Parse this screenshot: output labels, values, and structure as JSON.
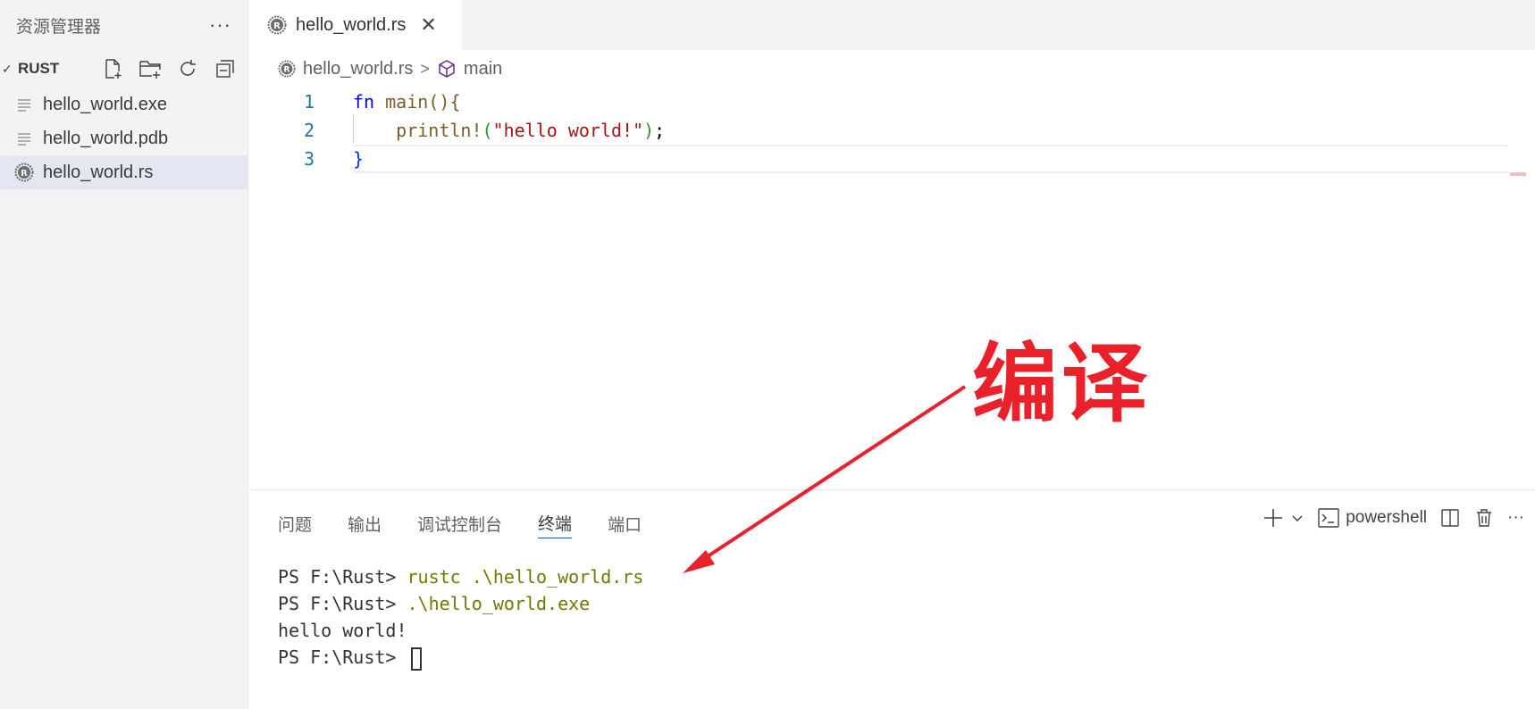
{
  "sidebar": {
    "title": "资源管理器",
    "more": "···",
    "section_title": "RUST",
    "section_chevron": "✓",
    "actions": [
      "new-file-icon",
      "new-folder-icon",
      "refresh-icon",
      "collapse-all-icon"
    ],
    "files": [
      {
        "name": "hello_world.exe",
        "icon": "file-lines-icon"
      },
      {
        "name": "hello_world.pdb",
        "icon": "file-lines-icon"
      },
      {
        "name": "hello_world.rs",
        "icon": "rust-icon",
        "selected": true
      }
    ]
  },
  "tab": {
    "label": "hello_world.rs",
    "close": "✕"
  },
  "breadcrumb": {
    "file": "hello_world.rs",
    "separator": ">",
    "symbol": "main"
  },
  "editor": {
    "line_numbers": [
      "1",
      "2",
      "3"
    ],
    "lines": [
      {
        "kw": "fn",
        "rest": " main(){"
      },
      {
        "fn": "println!",
        "str": "\"hello world!\"",
        "end": ";"
      },
      {
        "text": "}"
      }
    ]
  },
  "panel": {
    "tabs": [
      "问题",
      "输出",
      "调试控制台",
      "终端",
      "端口"
    ],
    "active_tab": "终端",
    "add": "+",
    "dropdown": "⌄",
    "shell_name": "powershell",
    "more": "···"
  },
  "terminal": {
    "prompt": "PS F:\\Rust> ",
    "cmd1": "rustc .\\hello_world.rs",
    "cmd2": ".\\hello_world.exe",
    "output": "hello world!"
  },
  "annotation": {
    "text": "编译",
    "color": "#e8212a"
  },
  "colors": {
    "accent": "#005fb8",
    "sidebar_bg": "#f3f3f3",
    "selected_bg": "#e4e6f1"
  }
}
